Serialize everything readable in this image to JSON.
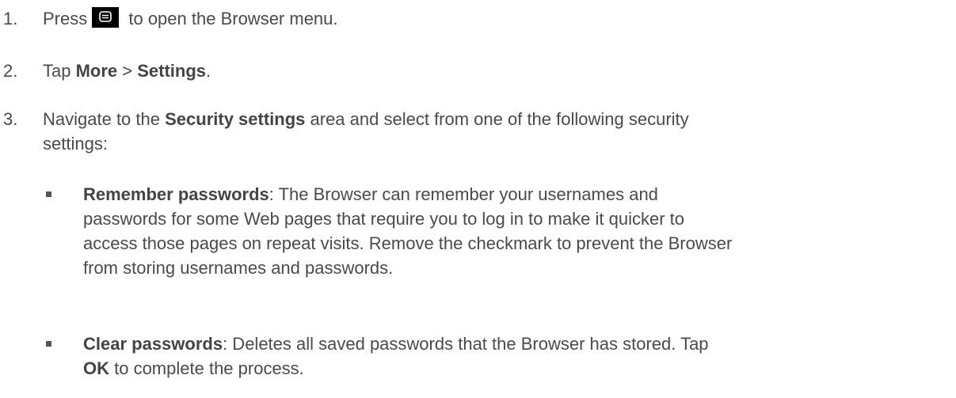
{
  "steps": [
    {
      "number": "1.",
      "press_word": "Press",
      "menu_icon": "menu-key-icon",
      "after_icon": " to open the Browser menu."
    },
    {
      "number": "2.",
      "tap_word": "Tap ",
      "more": "More",
      "sep": " > ",
      "settings": "Settings",
      "end": "."
    },
    {
      "number": "3.",
      "lead": "Navigate to the ",
      "area": "Security settings",
      "rest_line1": " area and select from one of the following security",
      "rest_line2": "settings:"
    }
  ],
  "bullets": [
    {
      "term": "Remember passwords",
      "line1": ": The Browser can remember your usernames and",
      "line2": "passwords for some Web pages that require you to log in to make it quicker to",
      "line3": "access those pages on repeat visits. Remove the checkmark to prevent the Browser",
      "line4": "from storing usernames and passwords."
    },
    {
      "term": "Clear passwords",
      "line1": ": Deletes all saved passwords that the Browser has stored. Tap",
      "ok": "OK",
      "line2_rest": " to complete the process."
    }
  ]
}
